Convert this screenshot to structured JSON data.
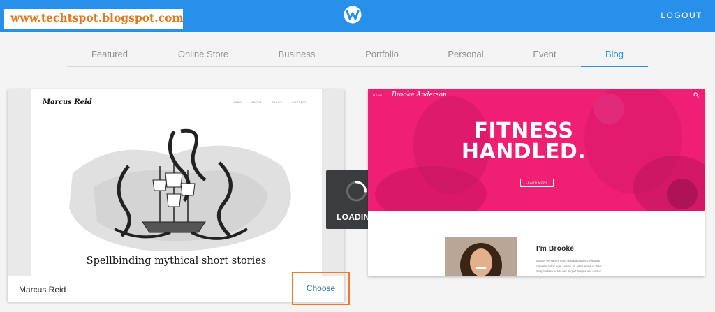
{
  "watermark": "www.techtspot.blogspot.com",
  "header": {
    "logo_icon": "weebly-w-icon",
    "logout_label": "LOGOUT"
  },
  "tabs": [
    {
      "label": "Featured",
      "active": false
    },
    {
      "label": "Online Store",
      "active": false
    },
    {
      "label": "Business",
      "active": false
    },
    {
      "label": "Portfolio",
      "active": false
    },
    {
      "label": "Personal",
      "active": false
    },
    {
      "label": "Event",
      "active": false
    },
    {
      "label": "Blog",
      "active": true
    }
  ],
  "theme_cards": [
    {
      "name": "Marcus Reid",
      "preview": {
        "site_title": "Marcus Reid",
        "nav": [
          "HOME",
          "ABOUT",
          "PAGES",
          "CONTACT"
        ],
        "heading": "Spellbinding mythical short stories"
      },
      "choose_label": "Choose"
    },
    {
      "preview": {
        "menu_label": "MENU",
        "brand": "Brooke Anderson",
        "hero_line1": "FITNESS",
        "hero_line2": "HANDLED.",
        "cta_label": "LEARN MORE",
        "about_title": "I'm Brooke",
        "about_lines": [
          "Integer vel sapien et mi gravida sodales. Aliquam",
          "convallis tellus eget sapien, sit amet lectus ut diam.",
          "Suspendisse et nisi nec aliquet magna nec cursus."
        ]
      }
    }
  ],
  "loading_label": "LOADING",
  "colors": {
    "header_blue": "#2990ea",
    "accent_orange": "#f0792a",
    "hero_pink": "#ef1f73",
    "link_blue": "#2a72b8"
  }
}
